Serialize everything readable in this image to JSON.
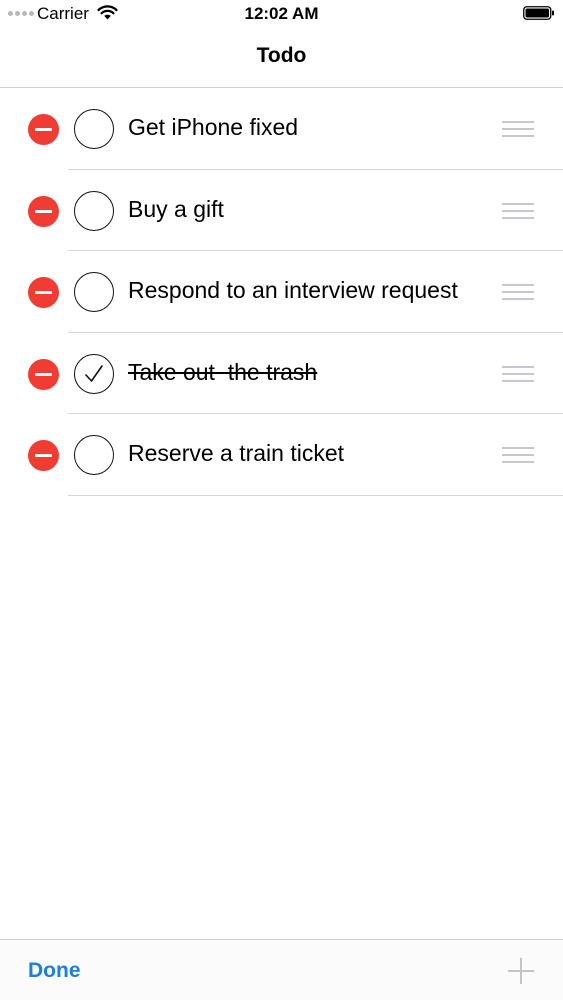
{
  "status_bar": {
    "carrier": "Carrier",
    "time": "12:02 AM",
    "icons": [
      "signal-dots-icon",
      "wifi-icon",
      "battery-icon"
    ]
  },
  "nav": {
    "title": "Todo"
  },
  "todos": [
    {
      "title": "Get iPhone fixed",
      "completed": false
    },
    {
      "title": "Buy a gift",
      "completed": false
    },
    {
      "title": "Respond to an interview request",
      "completed": false
    },
    {
      "title": "Take out  the trash",
      "completed": true
    },
    {
      "title": "Reserve a train ticket",
      "completed": false
    }
  ],
  "toolbar": {
    "done_label": "Done",
    "add_icon": "plus-icon"
  },
  "colors": {
    "delete_red": "#f03c33",
    "tint_blue": "#1a7fe0",
    "separator": "#d6d6da"
  }
}
